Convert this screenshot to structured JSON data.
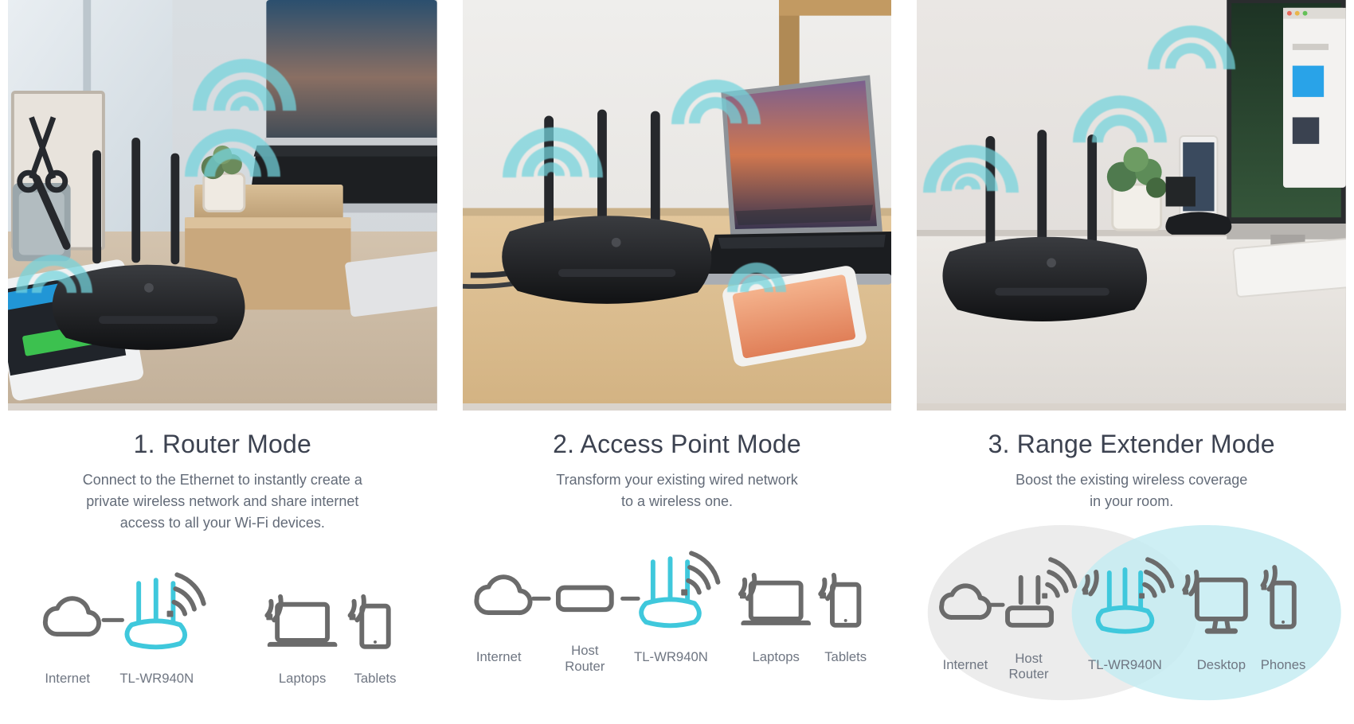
{
  "page": {
    "background": "#ffffff",
    "accent_cyan": "#3fc8dc",
    "icon_gray": "#6b6b6b",
    "title_color": "#3c4250",
    "body_color": "#636b78",
    "coverage_gray": "#ececec",
    "coverage_cyan": "#c5ecf2"
  },
  "panels": [
    {
      "id": "router-mode",
      "title": "1. Router Mode",
      "description": "Connect to the Ethernet to instantly create a private wireless network and share internet access to all your Wi-Fi devices.",
      "description_lines": [
        "Connect to the Ethernet to instantly create a",
        "private wireless network and share internet",
        "access to all your Wi-Fi devices."
      ],
      "photo_alt": "Black TL-WR940N router with three antennas on a wooden desk beside a laptop, picture frame and keyboard; cyan Wi-Fi arcs radiate from it.",
      "diagram": {
        "has_coverage_circles": false,
        "nodes": [
          {
            "name": "internet",
            "icon": "cloud-icon",
            "label": "Internet",
            "color": "#6b6b6b"
          },
          {
            "name": "tl-wr940n",
            "icon": "router-icon",
            "label": "TL-WR940N",
            "color": "#3fc8dc"
          },
          {
            "name": "laptops",
            "icon": "laptop-icon",
            "label": "Laptops",
            "color": "#6b6b6b"
          },
          {
            "name": "tablets",
            "icon": "tablet-icon",
            "label": "Tablets",
            "color": "#6b6b6b"
          }
        ],
        "connectors": [
          "internet-to-tl-wr940n"
        ]
      }
    },
    {
      "id": "access-point-mode",
      "title": "2. Access Point Mode",
      "description": "Transform your existing wired network to a wireless one.",
      "description_lines": [
        "Transform your existing wired network",
        "to a wireless one."
      ],
      "photo_alt": "Black TL-WR940N router with three antennas on a light wooden desk next to an open laptop and a smartphone; cyan Wi-Fi arcs radiate from router and phone.",
      "diagram": {
        "has_coverage_circles": false,
        "nodes": [
          {
            "name": "internet",
            "icon": "cloud-icon",
            "label": "Internet",
            "color": "#6b6b6b"
          },
          {
            "name": "host-router",
            "icon": "modem-icon",
            "label": "Host Router",
            "label_lines": [
              "Host",
              "Router"
            ],
            "color": "#6b6b6b"
          },
          {
            "name": "tl-wr940n",
            "icon": "router-icon",
            "label": "TL-WR940N",
            "color": "#3fc8dc"
          },
          {
            "name": "laptops",
            "icon": "laptop-icon",
            "label": "Laptops",
            "color": "#6b6b6b"
          },
          {
            "name": "tablets",
            "icon": "tablet-icon",
            "label": "Tablets",
            "color": "#6b6b6b"
          }
        ],
        "connectors": [
          "internet-to-host-router",
          "host-router-to-tl-wr940n"
        ]
      }
    },
    {
      "id": "range-extender-mode",
      "title": "3. Range Extender Mode",
      "description": "Boost the existing wireless coverage in your room.",
      "description_lines": [
        "Boost the existing wireless coverage",
        "in your room."
      ],
      "photo_alt": "Black TL-WR940N router with three antennas on a white desk beside a plant, docked smartphone, monitor and keyboard; cyan Wi-Fi arcs radiate from it.",
      "diagram": {
        "has_coverage_circles": true,
        "coverage": [
          {
            "name": "host-router-coverage",
            "color": "#ececec"
          },
          {
            "name": "extended-coverage",
            "color": "#c5ecf2"
          }
        ],
        "nodes": [
          {
            "name": "internet",
            "icon": "cloud-icon",
            "label": "Internet",
            "color": "#6b6b6b"
          },
          {
            "name": "host-router",
            "icon": "antenna-router-icon",
            "label": "Host Router",
            "label_lines": [
              "Host",
              "Router"
            ],
            "color": "#6b6b6b"
          },
          {
            "name": "tl-wr940n",
            "icon": "router-icon",
            "label": "TL-WR940N",
            "color": "#3fc8dc"
          },
          {
            "name": "desktop",
            "icon": "desktop-icon",
            "label": "Desktop",
            "color": "#6b6b6b"
          },
          {
            "name": "phones",
            "icon": "phone-icon",
            "label": "Phones",
            "color": "#6b6b6b"
          }
        ],
        "connectors": [
          "internet-to-host-router"
        ]
      }
    }
  ]
}
